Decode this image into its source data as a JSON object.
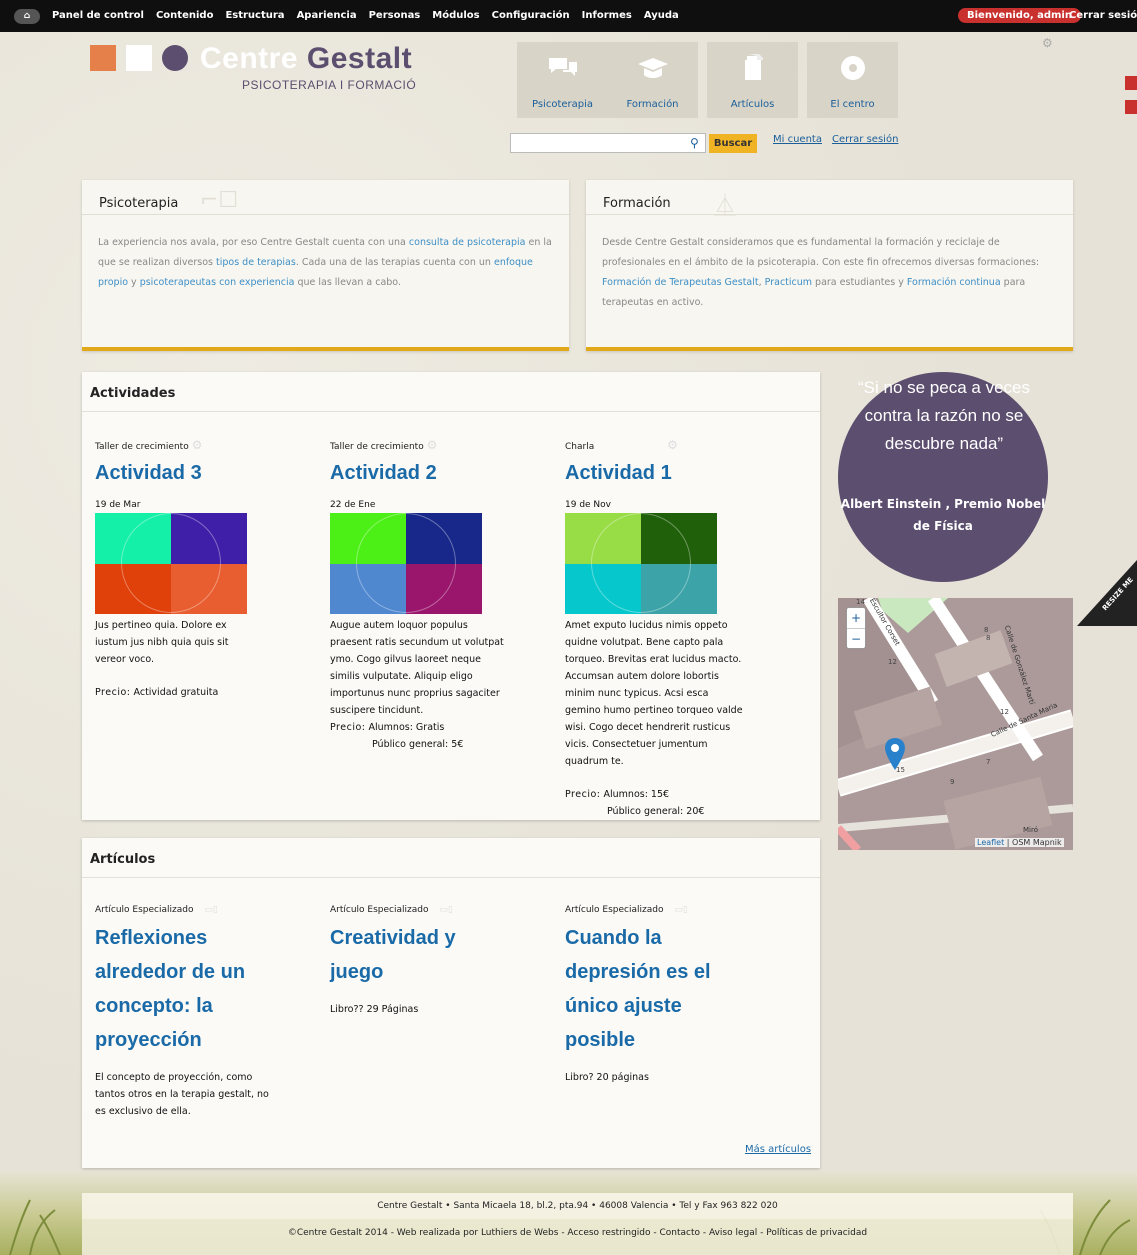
{
  "toolbar": {
    "home_icon": "home-icon",
    "items": [
      "Panel de control",
      "Contenido",
      "Estructura",
      "Apariencia",
      "Personas",
      "Módulos",
      "Configuración",
      "Informes",
      "Ayuda"
    ],
    "welcome": "Bienvenido, admin",
    "logout": "Cerrar sesión"
  },
  "logo": {
    "title_part1": "Centre",
    "title_part2": "Gestalt",
    "subtitle": "PSICOTERAPIA I FORMACIÓ",
    "colors": [
      "#e6804a",
      "#ffffff",
      "#5b4e6e"
    ]
  },
  "nav": [
    {
      "label": "Psicoterapia",
      "icon": "chat-bubbles-icon"
    },
    {
      "label": "Formación",
      "icon": "graduation-cap-icon"
    },
    {
      "label": "Artículos",
      "icon": "document-icon"
    },
    {
      "label": "El centro",
      "icon": "target-icon"
    }
  ],
  "search": {
    "button": "Buscar",
    "my_account": "Mi cuenta",
    "logout": "Cerrar sesión"
  },
  "intro": {
    "psicoterapia": {
      "title": "Psicoterapia",
      "t1": "La experiencia nos avala, por eso Centre Gestalt cuenta con una ",
      "l1": "consulta de psicoterapia",
      "t2": " en la que se realizan diversos ",
      "l2": "tipos de terapias",
      "t3": ". Cada una de las terapias cuenta con un ",
      "l3": "enfoque propio",
      "t4": " y ",
      "l4": "psicoterapeutas con experiencia",
      "t5": " que las llevan a cabo."
    },
    "formacion": {
      "title": "Formación",
      "t1": "Desde Centre Gestalt consideramos que es fundamental la formación y reciclaje de profesionales en el ámbito de la psicoterapia. Con este fin ofrecemos diversas formaciones: ",
      "l1": "Formación de Terapeutas Gestalt",
      "t2": ", ",
      "l2": "Practicum",
      "t3": " para estudiantes y ",
      "l3": "Formación continua",
      "t4": " para terapeutas en activo."
    }
  },
  "actividades": {
    "title": "Actividades",
    "items": [
      {
        "category": "Taller de crecimiento",
        "title": "Actividad 3",
        "date": "19 de Mar",
        "colors": [
          "#14f0a8",
          "#3f1fa8",
          "#e0400a",
          "#e85e30"
        ],
        "body": "Jus pertineo quia. Dolore ex iustum jus nibh quia quis sit vereor voco.",
        "price_label": "Precio:",
        "price1": "Actividad gratuita",
        "price2": ""
      },
      {
        "category": "Taller de crecimiento",
        "title": "Actividad 2",
        "date": "22 de Ene",
        "colors": [
          "#4cf016",
          "#18288a",
          "#5088d0",
          "#9a166c"
        ],
        "body": "Augue autem loquor populus praesent ratis secundum ut volutpat ymo. Cogo gilvus laoreet neque similis vulputate. Aliquip eligo importunus nunc proprius sagaciter suscipere tincidunt.",
        "price_label": "Precio:",
        "price1": "Alumnos: Gratis",
        "price2": "Público general: 5€"
      },
      {
        "category": "Charla",
        "title": "Actividad 1",
        "date": "19 de Nov",
        "colors": [
          "#98dc46",
          "#20600a",
          "#06c8cc",
          "#3ca4a8"
        ],
        "body": "Amet exputo lucidus nimis oppeto quidne volutpat. Bene capto pala torqueo. Brevitas erat lucidus macto. Accumsan autem dolore lobortis minim nunc typicus. Acsi esca gemino humo pertineo torqueo valde wisi. Cogo decet hendrerit rusticus vicis. Consectetuer jumentum quadrum te.",
        "price_label": "Precio:",
        "price1": "Alumnos: 15€",
        "price2": "Público general: 20€"
      }
    ]
  },
  "quote": {
    "text": "“Si no se peca a veces contra la razón no se descubre nada”",
    "author": "Albert Einstein , Premio Nobel de Física"
  },
  "map": {
    "zoom_in": "+",
    "zoom_out": "−",
    "attribution_link": "Leaflet",
    "attribution_text": " | OSM Mapnik",
    "streets": [
      "Calle de Santa Maria",
      "Calle de González Martí",
      "Escultor Corset",
      "Miró"
    ],
    "numbers": [
      "14",
      "12",
      "8",
      "8",
      "12",
      "7",
      "15",
      "9"
    ]
  },
  "resize": {
    "label": "RESIZE ME"
  },
  "articulos": {
    "title": "Artículos",
    "more": "Más artículos",
    "items": [
      {
        "category": "Artículo Especializado",
        "title": "Reflexiones alrededor de un concepto: la proyección",
        "body": "El concepto de proyección, como tantos otros en la terapia gestalt, no es exclusivo de ella."
      },
      {
        "category": "Artículo Especializado",
        "title": "Creatividad y juego",
        "body": "Libro?? 29 Páginas"
      },
      {
        "category": "Artículo Especializado",
        "title": "Cuando la depresión es el único ajuste posible",
        "body": "Libro? 20 páginas"
      }
    ]
  },
  "footer": {
    "address": "Centre Gestalt • Santa Micaela 18, bl.2, pta.94 • 46008 Valencia • Tel y Fax 963 822 020",
    "credits": "©Centre Gestalt 2014 - Web realizada por Luthiers de Webs - Acceso restringido - Contacto - Aviso legal - Políticas de privacidad"
  }
}
